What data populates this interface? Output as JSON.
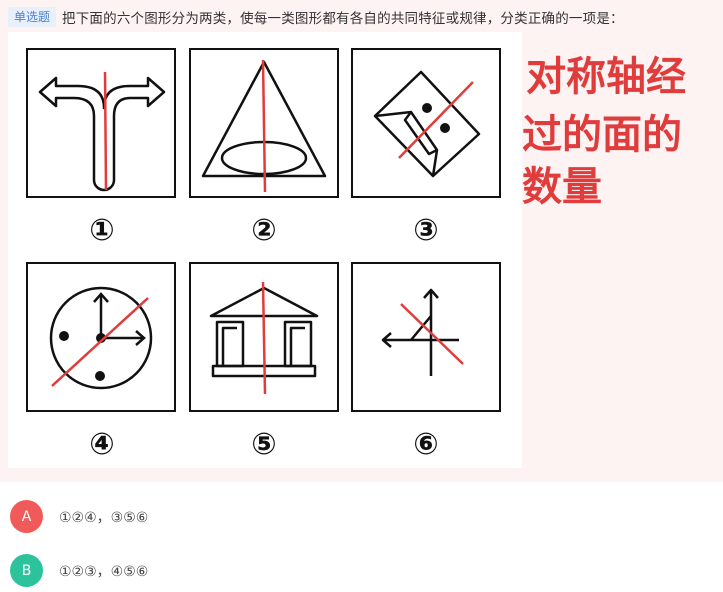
{
  "question": {
    "type_tag": "单选题",
    "text": "把下面的六个图形分为两类，使每一类图形都有各自的共同特征或规律，分类正确的一项是："
  },
  "figures": [
    {
      "number": "①"
    },
    {
      "number": "②"
    },
    {
      "number": "③"
    },
    {
      "number": "④"
    },
    {
      "number": "⑤"
    },
    {
      "number": "⑥"
    }
  ],
  "annotation": {
    "lines": [
      "对称轴经",
      "过的面的",
      "数量"
    ],
    "color": "#e03c3c"
  },
  "options": [
    {
      "letter": "A",
      "text": "①②④，③⑤⑥",
      "color": "#f05a5a"
    },
    {
      "letter": "B",
      "text": "①②③，④⑤⑥",
      "color": "#2cc39c"
    }
  ]
}
